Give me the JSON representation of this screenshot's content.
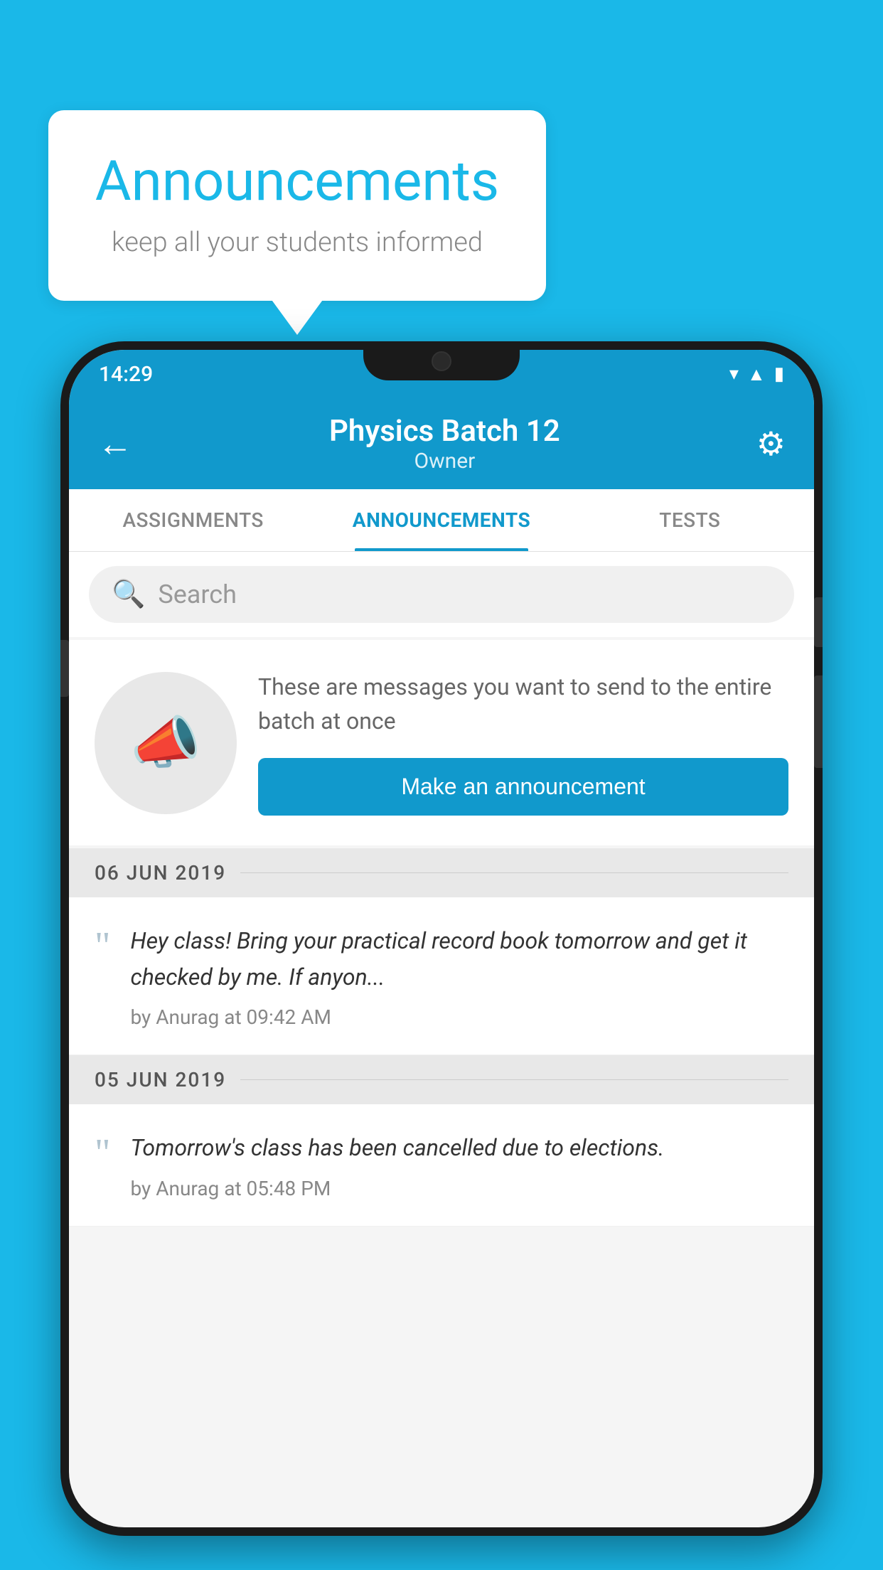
{
  "background_color": "#1ab8e8",
  "speech_bubble": {
    "title": "Announcements",
    "subtitle": "keep all your students informed"
  },
  "phone": {
    "status_bar": {
      "time": "14:29",
      "icons": [
        "wifi",
        "signal",
        "battery"
      ]
    },
    "app_bar": {
      "title": "Physics Batch 12",
      "subtitle": "Owner",
      "back_label": "←",
      "settings_label": "⚙"
    },
    "tabs": [
      {
        "label": "ASSIGNMENTS",
        "active": false
      },
      {
        "label": "ANNOUNCEMENTS",
        "active": true
      },
      {
        "label": "TESTS",
        "active": false
      }
    ],
    "search": {
      "placeholder": "Search"
    },
    "promo_section": {
      "description": "These are messages you want to send to the entire batch at once",
      "button_label": "Make an announcement"
    },
    "announcements": [
      {
        "date": "06  JUN  2019",
        "text": "Hey class! Bring your practical record book tomorrow and get it checked by me. If anyon...",
        "meta": "by Anurag at 09:42 AM"
      },
      {
        "date": "05  JUN  2019",
        "text": "Tomorrow's class has been cancelled due to elections.",
        "meta": "by Anurag at 05:48 PM"
      }
    ]
  }
}
